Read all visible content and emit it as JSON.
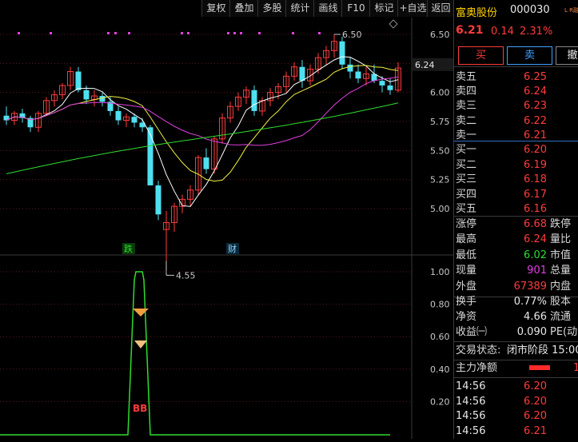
{
  "toolbar": {
    "buttons": [
      "复权",
      "叠加",
      "多股",
      "统计",
      "画线",
      "F10",
      "标记",
      "+自选",
      "返回"
    ]
  },
  "chart": {
    "price_axis": [
      "6.50",
      "6.25",
      "6.00",
      "5.75",
      "5.50",
      "5.25",
      "5.00"
    ],
    "current_price_tag": "6.24",
    "high_annotation": "6.50",
    "low_annotation": "4.55",
    "event_markers": [
      "跌",
      "财"
    ],
    "indicator_axis": [
      "1.00",
      "0.80",
      "0.60",
      "0.40",
      "0.20"
    ],
    "indicator_label": "BB"
  },
  "chart_data": {
    "type": "candlestick",
    "ohlc_note": "daily candles, approximate",
    "candles": [
      [
        5.8,
        5.88,
        5.72,
        5.76
      ],
      [
        5.76,
        5.84,
        5.72,
        5.82
      ],
      [
        5.82,
        5.86,
        5.74,
        5.78
      ],
      [
        5.78,
        5.8,
        5.66,
        5.7
      ],
      [
        5.7,
        5.84,
        5.66,
        5.82
      ],
      [
        5.82,
        5.96,
        5.8,
        5.93
      ],
      [
        5.93,
        6.02,
        5.88,
        5.98
      ],
      [
        5.98,
        6.08,
        5.94,
        6.06
      ],
      [
        6.06,
        6.22,
        6.02,
        6.18
      ],
      [
        6.18,
        6.22,
        6.0,
        6.02
      ],
      [
        6.02,
        6.06,
        5.9,
        5.94
      ],
      [
        5.94,
        6.02,
        5.88,
        5.97
      ],
      [
        5.97,
        6.0,
        5.88,
        5.92
      ],
      [
        5.92,
        5.96,
        5.8,
        5.84
      ],
      [
        5.84,
        5.88,
        5.72,
        5.76
      ],
      [
        5.76,
        5.82,
        5.7,
        5.79
      ],
      [
        5.79,
        5.82,
        5.7,
        5.74
      ],
      [
        5.74,
        5.78,
        5.66,
        5.7
      ],
      [
        5.7,
        5.72,
        5.32,
        5.2
      ],
      [
        5.2,
        5.24,
        4.9,
        4.95
      ],
      [
        4.82,
        4.98,
        4.55,
        4.88
      ],
      [
        4.88,
        5.05,
        4.8,
        5.02
      ],
      [
        5.02,
        5.12,
        4.96,
        5.08
      ],
      [
        5.08,
        5.2,
        5.02,
        5.16
      ],
      [
        5.16,
        5.46,
        5.12,
        5.44
      ],
      [
        5.44,
        5.52,
        5.3,
        5.34
      ],
      [
        5.34,
        5.62,
        5.3,
        5.6
      ],
      [
        5.6,
        5.82,
        5.56,
        5.78
      ],
      [
        5.78,
        5.92,
        5.74,
        5.88
      ],
      [
        5.88,
        6.0,
        5.84,
        5.96
      ],
      [
        5.96,
        6.05,
        5.9,
        6.02
      ],
      [
        6.02,
        6.06,
        5.8,
        5.84
      ],
      [
        5.84,
        5.96,
        5.8,
        5.93
      ],
      [
        5.93,
        6.04,
        5.88,
        6.0
      ],
      [
        6.0,
        6.08,
        5.94,
        6.05
      ],
      [
        6.05,
        6.18,
        6.0,
        6.14
      ],
      [
        6.14,
        6.26,
        6.1,
        6.22
      ],
      [
        6.22,
        6.28,
        6.04,
        6.1
      ],
      [
        6.1,
        6.24,
        6.06,
        6.2
      ],
      [
        6.2,
        6.34,
        6.16,
        6.3
      ],
      [
        6.3,
        6.4,
        6.24,
        6.36
      ],
      [
        6.36,
        6.5,
        6.3,
        6.44
      ],
      [
        6.44,
        6.48,
        6.2,
        6.24
      ],
      [
        6.24,
        6.3,
        6.12,
        6.18
      ],
      [
        6.18,
        6.24,
        6.08,
        6.12
      ],
      [
        6.12,
        6.22,
        6.06,
        6.16
      ],
      [
        6.16,
        6.24,
        6.08,
        6.1
      ],
      [
        6.1,
        6.14,
        6.0,
        6.06
      ],
      [
        6.06,
        6.12,
        5.98,
        6.02
      ],
      [
        6.02,
        6.26,
        6.0,
        6.21
      ]
    ]
  },
  "panel": {
    "name": "富奥股份",
    "code": "000030",
    "flags": "L R融",
    "price": "6.21",
    "change": "0.14",
    "change_pct": "2.31%",
    "buy_btn": "买",
    "sell_btn": "卖",
    "cancel_btn": "撤",
    "asks": [
      {
        "label": "卖五",
        "price": "6.25"
      },
      {
        "label": "卖四",
        "price": "6.24"
      },
      {
        "label": "卖三",
        "price": "6.23"
      },
      {
        "label": "卖二",
        "price": "6.22"
      },
      {
        "label": "卖一",
        "price": "6.21"
      }
    ],
    "bids": [
      {
        "label": "买一",
        "price": "6.20"
      },
      {
        "label": "买二",
        "price": "6.19"
      },
      {
        "label": "买三",
        "price": "6.18"
      },
      {
        "label": "买四",
        "price": "6.17"
      },
      {
        "label": "买五",
        "price": "6.16"
      }
    ],
    "stats": [
      {
        "l": "涨停",
        "v": "6.68",
        "r": "跌停",
        "c": "red"
      },
      {
        "l": "最高",
        "v": "6.24",
        "r": "量比",
        "c": "red"
      },
      {
        "l": "最低",
        "v": "6.02",
        "r": "市值",
        "c": "green"
      },
      {
        "l": "现量",
        "v": "901",
        "r": "总量",
        "c": "magenta"
      },
      {
        "l": "外盘",
        "v": "67389",
        "r": "内盘",
        "c": "red"
      }
    ],
    "stats2": [
      {
        "l": "换手",
        "v": "0.77%",
        "r": "股本"
      },
      {
        "l": "净资",
        "v": "4.66",
        "r": "流通"
      },
      {
        "l": "收益㈠",
        "v": "0.090",
        "r": "PE(动"
      }
    ],
    "trade_status_label": "交易状态:",
    "trade_status_value": "闭市阶段 15:00",
    "main_net_label": "主力净额",
    "main_net_value": "1",
    "ticks": [
      {
        "t": "14:56",
        "p": "6.20"
      },
      {
        "t": "14:56",
        "p": "6.20"
      },
      {
        "t": "14:56",
        "p": "6.20"
      },
      {
        "t": "14:56",
        "p": "6.21"
      }
    ]
  }
}
